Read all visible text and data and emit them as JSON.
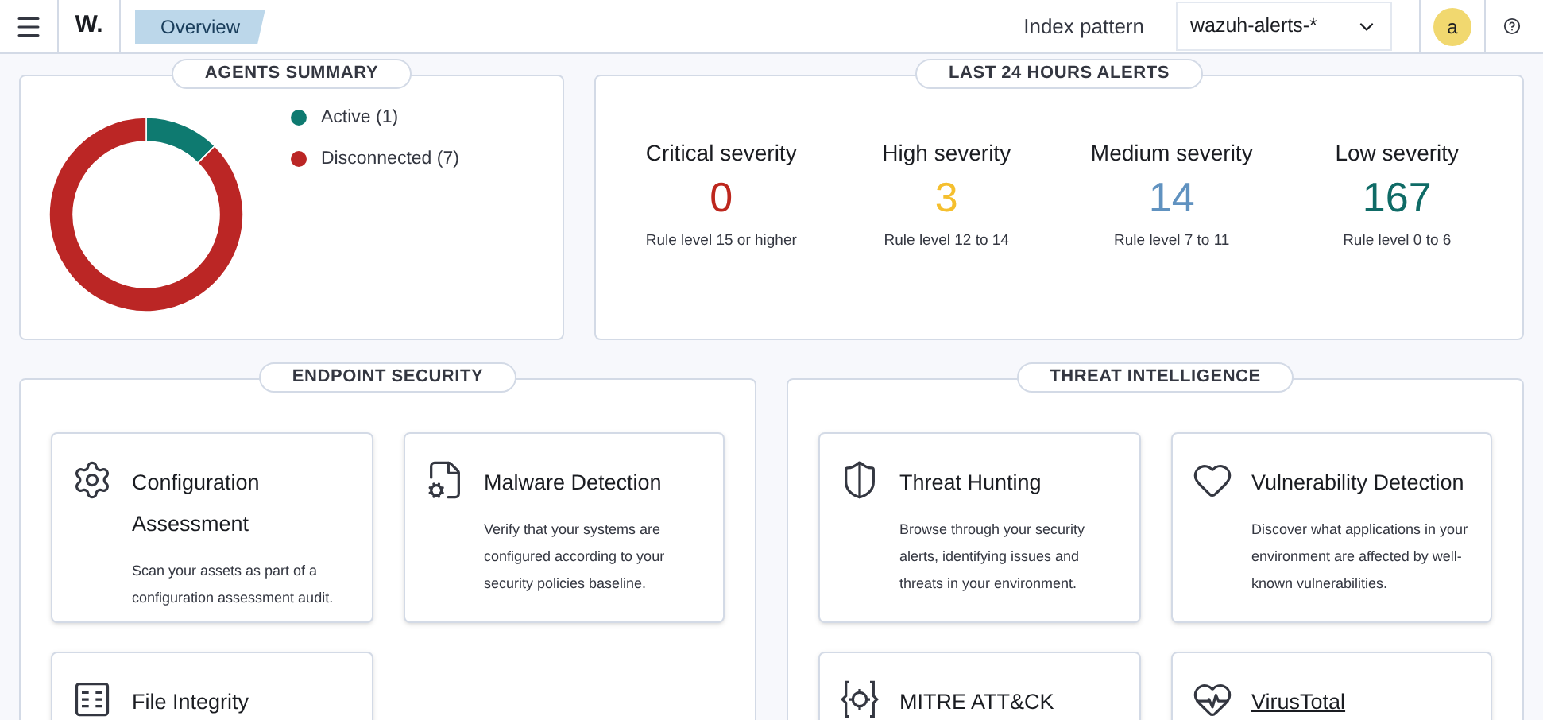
{
  "header": {
    "logo": "W.",
    "breadcrumb": "Overview",
    "index_pattern_label": "Index pattern",
    "index_pattern_value": "wazuh-alerts-*",
    "avatar": "a"
  },
  "agents_summary": {
    "title": "AGENTS SUMMARY",
    "chart_data": {
      "type": "donut",
      "categories": [
        "Active (1)",
        "Disconnected (7)"
      ],
      "values": [
        1,
        7
      ],
      "colors": [
        "#0e7a70",
        "#bb2625"
      ]
    }
  },
  "alerts": {
    "title": "LAST 24 HOURS ALERTS",
    "items": [
      {
        "label": "Critical severity",
        "value": "0",
        "color": "#bd271e",
        "note": "Rule level 15 or higher"
      },
      {
        "label": "High severity",
        "value": "3",
        "color": "#f5bf2e",
        "note": "Rule level 12 to 14"
      },
      {
        "label": "Medium severity",
        "value": "14",
        "color": "#6092c0",
        "note": "Rule level 7 to 11"
      },
      {
        "label": "Low severity",
        "value": "167",
        "color": "#0f6b66",
        "note": "Rule level 0 to 6"
      }
    ]
  },
  "sections": [
    {
      "title": "ENDPOINT SECURITY",
      "cards": [
        {
          "title": "Configuration Assessment",
          "description": "Scan your assets as part of a configuration assessment audit.",
          "link": false
        },
        {
          "title": "Malware Detection",
          "description": "Verify that your systems are configured according to your security policies baseline.",
          "link": false
        },
        {
          "title": "File Integrity",
          "link": false
        }
      ]
    },
    {
      "title": "THREAT INTELLIGENCE",
      "cards": [
        {
          "title": "Threat Hunting",
          "description": "Browse through your security alerts, identifying issues and threats in your environment.",
          "link": false
        },
        {
          "title": "Vulnerability Detection",
          "description": "Discover what applications in your environment are affected by well-known vulnerabilities.",
          "link": false
        },
        {
          "title": "MITRE ATT&CK",
          "link": false
        },
        {
          "title": "VirusTotal",
          "link": true
        }
      ]
    }
  ]
}
